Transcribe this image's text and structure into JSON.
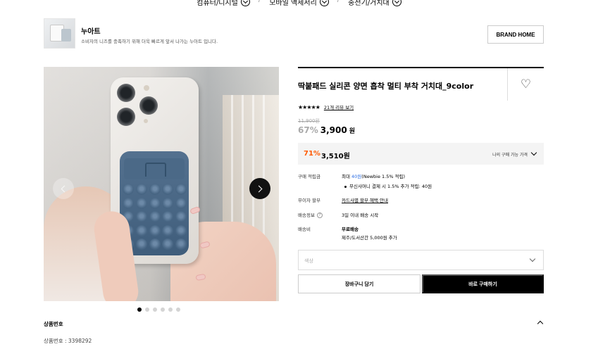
{
  "breadcrumb": [
    {
      "label": "컴퓨터/디지털"
    },
    {
      "label": "모바일 액세서리"
    },
    {
      "label": "충전기/거치대"
    }
  ],
  "brand": {
    "name": "누아트",
    "description": "소비자의 니즈를 충족하기 위해 더욱 빠르게 앞서 나가는 누아트 입니다.",
    "home_label": "BRAND HOME"
  },
  "gallery": {
    "slide_count": 6,
    "active_index": 0
  },
  "product": {
    "title": "딱붙패드 실리콘 양면 흡착 멀티 부착 거치대_9color",
    "stars": "★★★★★",
    "rating": 4.5,
    "review_link": "21개 리뷰 보기",
    "original_price": "11,900원",
    "discount_percent": "67%",
    "sale_price": "3,900",
    "sale_unit": "원",
    "member_discount_percent": "71%",
    "member_price": "3,510원",
    "member_price_label": "나의 구매 가능 가격"
  },
  "details": {
    "points_label": "구매 적립금",
    "points_prefix": "최대 ",
    "points_amount": "40원",
    "points_suffix": "(Newbie 1.5% 적립)",
    "points_extra": "무신사머니 결제 시 1.5% 추가 적립: 40원",
    "installment_label": "무이자 할부",
    "installment_value": "카드사별 할부 혜택 안내",
    "shipping_info_label": "배송정보",
    "shipping_info_help": "?",
    "shipping_info_value": "3일 이내 배송 시작",
    "shipping_fee_label": "배송비",
    "shipping_fee_value": "무료배송",
    "shipping_fee_extra": "제주/도서산간 5,000원 추가"
  },
  "options": {
    "color_placeholder": "색상"
  },
  "actions": {
    "cart_label": "장바구니 담기",
    "buy_label": "바로 구매하기"
  },
  "product_number": {
    "title": "상품번호",
    "value": "상품번호 : 3398292"
  }
}
